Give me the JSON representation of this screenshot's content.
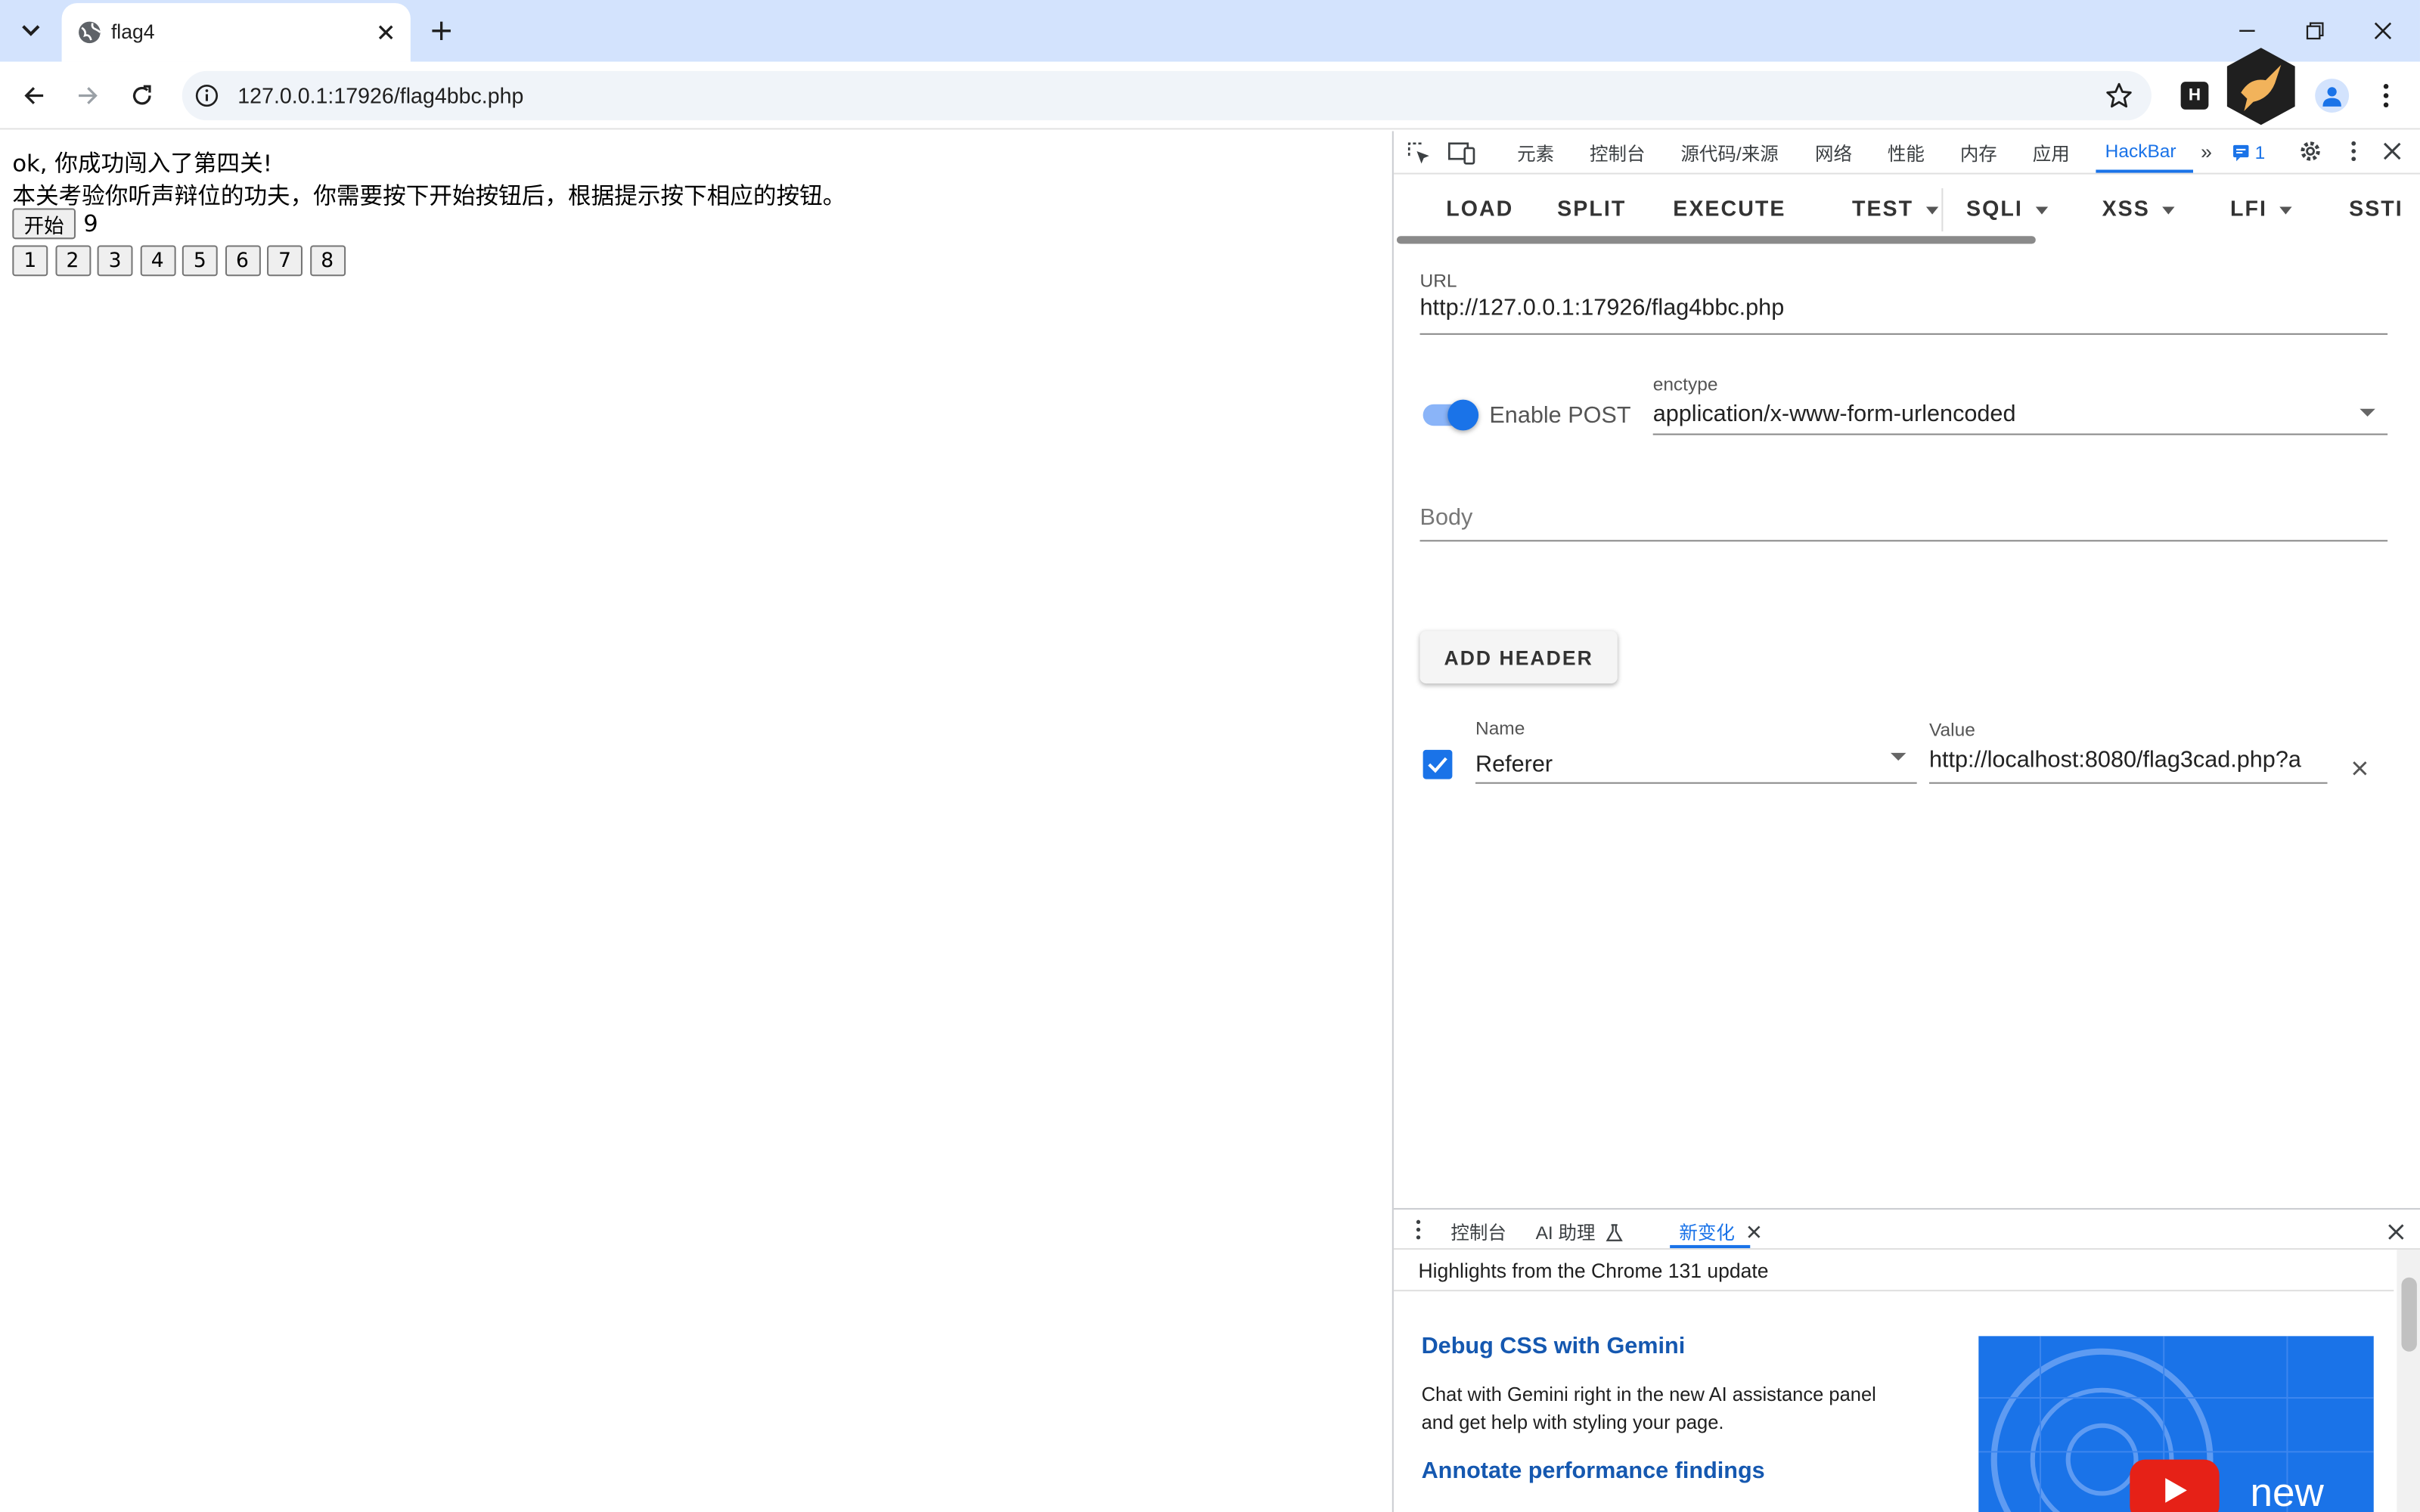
{
  "browser": {
    "tab_title": "flag4",
    "url": "127.0.0.1:17926/flag4bbc.php"
  },
  "page": {
    "line1": "ok, 你成功闯入了第四关!",
    "line2": "本关考验你听声辩位的功夫，你需要按下开始按钮后，根据提示按下相应的按钮。",
    "start_label": "开始",
    "counter": "9",
    "number_buttons": [
      "1",
      "2",
      "3",
      "4",
      "5",
      "6",
      "7",
      "8"
    ]
  },
  "devtools": {
    "tabs": [
      "元素",
      "控制台",
      "源代码/来源",
      "网络",
      "性能",
      "内存",
      "应用",
      "HackBar"
    ],
    "issues_count": "1"
  },
  "hackbar": {
    "toolbar": [
      "LOAD",
      "SPLIT",
      "EXECUTE",
      "TEST",
      "SQLI",
      "XSS",
      "LFI",
      "SSTI"
    ],
    "url_label": "URL",
    "url_value": "http://127.0.0.1:17926/flag4bbc.php",
    "enable_post_label": "Enable POST",
    "enctype_label": "enctype",
    "enctype_value": "application/x-www-form-urlencoded",
    "body_placeholder": "Body",
    "add_header_label": "ADD HEADER",
    "header_name_label": "Name",
    "header_name_value": "Referer",
    "header_value_label": "Value",
    "header_value_value": "http://localhost:8080/flag3cad.php?a"
  },
  "drawer": {
    "tabs": [
      "控制台",
      "AI 助理",
      "新变化"
    ],
    "highlights_title": "Highlights from the Chrome 131 update",
    "item1_title": "Debug CSS with Gemini",
    "item1_text": "Chat with Gemini right in the new AI assistance panel and get help with styling your page.",
    "item2_title": "Annotate performance findings",
    "video_text": "new"
  },
  "colors": {
    "titlebar": "#d3e3fd",
    "accent": "#1a73e8",
    "link": "#1558b0"
  }
}
